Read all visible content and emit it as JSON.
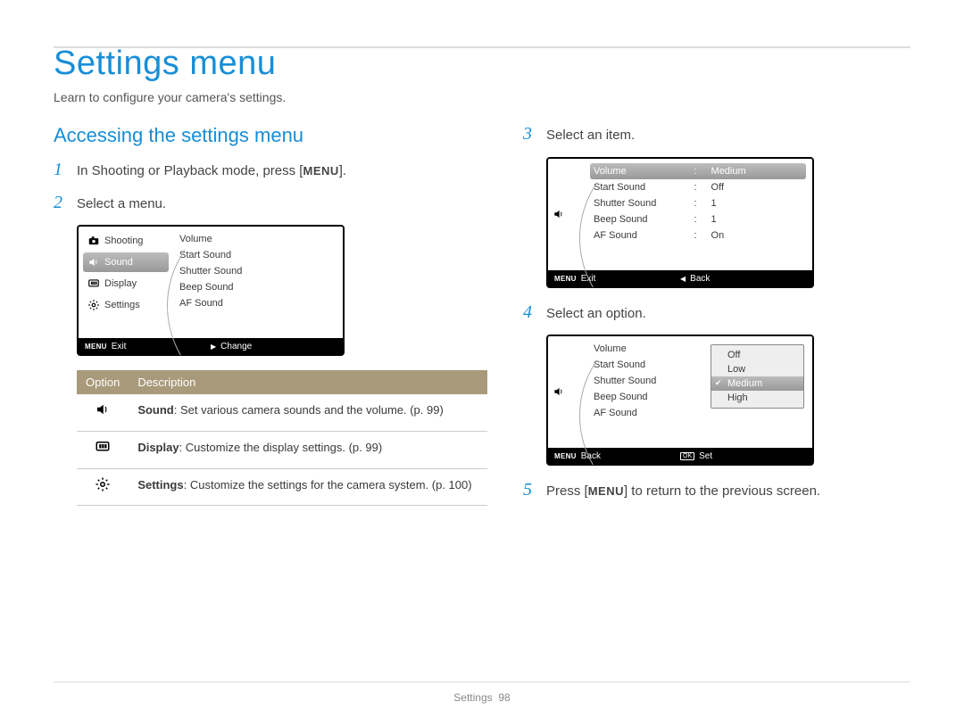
{
  "page_title": "Settings menu",
  "page_subtitle": "Learn to configure your camera's settings.",
  "section_heading": "Accessing the settings menu",
  "menu_key": "MENU",
  "steps": {
    "s1": {
      "prefix": "In Shooting or Playback mode, press [",
      "suffix": "]."
    },
    "s2": "Select a menu.",
    "s3": "Select an item.",
    "s4": "Select an option.",
    "s5a": "Press [",
    "s5b": "] to return to the previous screen."
  },
  "lcd1": {
    "categories": [
      "Shooting",
      "Sound",
      "Display",
      "Settings"
    ],
    "selected_index": 1,
    "options": [
      "Volume",
      "Start Sound",
      "Shutter Sound",
      "Beep Sound",
      "AF Sound"
    ],
    "footer_left_icon": "MENU",
    "footer_left_text": "Exit",
    "footer_right_icon": "▶",
    "footer_right_text": "Change"
  },
  "lcd2": {
    "options": [
      {
        "label": "Volume",
        "value": "Medium",
        "selected": true
      },
      {
        "label": "Start Sound",
        "value": "Off"
      },
      {
        "label": "Shutter Sound",
        "value": "1"
      },
      {
        "label": "Beep Sound",
        "value": "1"
      },
      {
        "label": "AF Sound",
        "value": "On"
      }
    ],
    "footer_left_icon": "MENU",
    "footer_left_text": "Exit",
    "footer_right_icon": "◀",
    "footer_right_text": "Back"
  },
  "lcd3": {
    "options": [
      "Volume",
      "Start Sound",
      "Shutter Sound",
      "Beep Sound",
      "AF Sound"
    ],
    "popup": {
      "options": [
        "Off",
        "Low",
        "Medium",
        "High"
      ],
      "selected_index": 2
    },
    "footer_left_icon": "MENU",
    "footer_left_text": "Back",
    "footer_right_icon": "OK",
    "footer_right_text": "Set"
  },
  "opt_table": {
    "head_option": "Option",
    "head_desc": "Description",
    "rows": [
      {
        "icon": "speaker",
        "bold": "Sound",
        "rest": ": Set various camera sounds and the volume. (p. 99)"
      },
      {
        "icon": "display",
        "bold": "Display",
        "rest": ": Customize the display settings. (p. 99)"
      },
      {
        "icon": "gear",
        "bold": "Settings",
        "rest": ": Customize the settings for the camera system. (p. 100)"
      }
    ]
  },
  "footer_section": "Settings",
  "footer_page": "98"
}
